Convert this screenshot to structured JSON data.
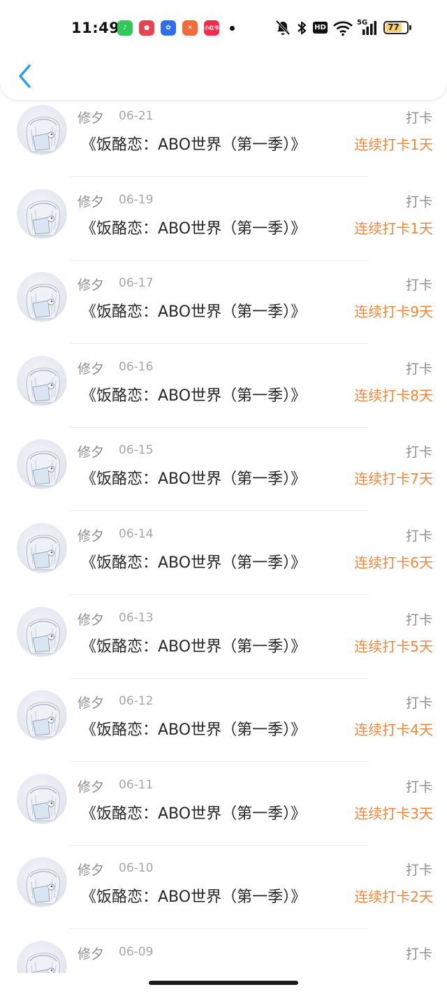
{
  "status_bar": {
    "time": "11:49",
    "notification_apps": [
      {
        "name": "qq-music-icon",
        "color": "#32c75a",
        "label": ""
      },
      {
        "name": "weibo-bird-icon",
        "color": "#e84352",
        "label": ""
      },
      {
        "name": "baidu-paw-icon",
        "color": "#2f6ee6",
        "label": ""
      },
      {
        "name": "xiaohongshu-runner-icon",
        "color": "#f26a3a",
        "label": ""
      },
      {
        "name": "little-red-book-icon",
        "color": "#ef2d4a",
        "label": "小红书"
      }
    ],
    "hd_label": "HD",
    "network_label": "5G",
    "battery_level": "77"
  },
  "header": {
    "back_icon": "chevron-left-icon",
    "accent_color": "#2d9cf0"
  },
  "colors": {
    "streak": "#f0863c",
    "meta": "#8e8e8e"
  },
  "checkins": [
    {
      "user": "修夕",
      "date": "06-21",
      "action": "打卡",
      "book": "《饭酪恋：ABO世界（第一季）》",
      "streak": "连续打卡1天"
    },
    {
      "user": "修夕",
      "date": "06-19",
      "action": "打卡",
      "book": "《饭酪恋：ABO世界（第一季）》",
      "streak": "连续打卡1天"
    },
    {
      "user": "修夕",
      "date": "06-17",
      "action": "打卡",
      "book": "《饭酪恋：ABO世界（第一季）》",
      "streak": "连续打卡9天"
    },
    {
      "user": "修夕",
      "date": "06-16",
      "action": "打卡",
      "book": "《饭酪恋：ABO世界（第一季）》",
      "streak": "连续打卡8天"
    },
    {
      "user": "修夕",
      "date": "06-15",
      "action": "打卡",
      "book": "《饭酪恋：ABO世界（第一季）》",
      "streak": "连续打卡7天"
    },
    {
      "user": "修夕",
      "date": "06-14",
      "action": "打卡",
      "book": "《饭酪恋：ABO世界（第一季）》",
      "streak": "连续打卡6天"
    },
    {
      "user": "修夕",
      "date": "06-13",
      "action": "打卡",
      "book": "《饭酪恋：ABO世界（第一季）》",
      "streak": "连续打卡5天"
    },
    {
      "user": "修夕",
      "date": "06-12",
      "action": "打卡",
      "book": "《饭酪恋：ABO世界（第一季）》",
      "streak": "连续打卡4天"
    },
    {
      "user": "修夕",
      "date": "06-11",
      "action": "打卡",
      "book": "《饭酪恋：ABO世界（第一季）》",
      "streak": "连续打卡3天"
    },
    {
      "user": "修夕",
      "date": "06-10",
      "action": "打卡",
      "book": "《饭酪恋：ABO世界（第一季）》",
      "streak": "连续打卡2天"
    },
    {
      "user": "修夕",
      "date": "06-09",
      "action": "打卡",
      "book": "",
      "streak": ""
    }
  ]
}
